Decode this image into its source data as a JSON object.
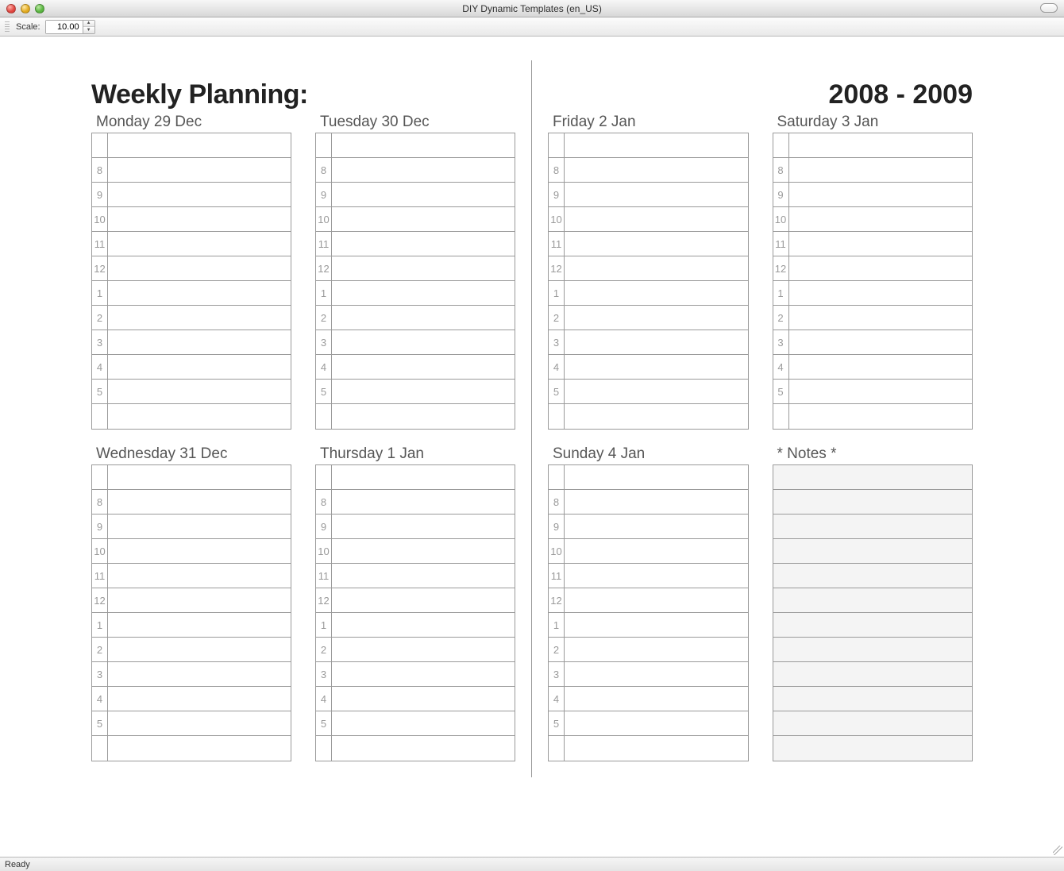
{
  "window": {
    "title": "DIY Dynamic Templates (en_US)"
  },
  "toolbar": {
    "scale_label": "Scale:",
    "scale_value": "10.00"
  },
  "template": {
    "heading_left": "Weekly Planning:",
    "heading_right": "2008 - 2009",
    "notes_label": "* Notes *",
    "hours": [
      "",
      "8",
      "9",
      "10",
      "11",
      "12",
      "1",
      "2",
      "3",
      "4",
      "5",
      ""
    ],
    "days": [
      {
        "id": "mon",
        "label": "Monday 29 Dec"
      },
      {
        "id": "tue",
        "label": "Tuesday 30 Dec"
      },
      {
        "id": "wed",
        "label": "Wednesday 31 Dec"
      },
      {
        "id": "thu",
        "label": "Thursday 1 Jan"
      },
      {
        "id": "fri",
        "label": "Friday 2 Jan"
      },
      {
        "id": "sat",
        "label": "Saturday 3 Jan"
      },
      {
        "id": "sun",
        "label": "Sunday 4 Jan"
      }
    ]
  },
  "status": {
    "text": "Ready"
  }
}
